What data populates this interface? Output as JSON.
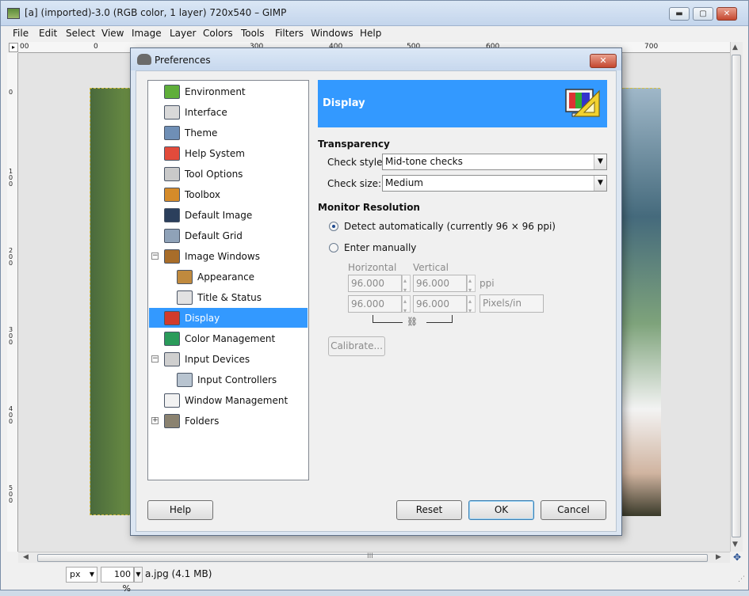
{
  "gimp": {
    "title": "[a] (imported)-3.0 (RGB color, 1 layer) 720x540 – GIMP",
    "window_buttons": {
      "minimize": "▬",
      "maximize": "▢",
      "close": "✕"
    },
    "menu": [
      "File",
      "Edit",
      "Select",
      "View",
      "Image",
      "Layer",
      "Colors",
      "Tools",
      "Filters",
      "Windows",
      "Help"
    ],
    "ruler_top_labels": [
      "00",
      "0",
      "300",
      "400",
      "500",
      "600",
      "700"
    ],
    "ruler_left_labels": [
      "0",
      "100",
      "200",
      "300",
      "400",
      "500"
    ],
    "status": {
      "unit": "px",
      "zoom": "100 %",
      "file": "a.jpg (4.1 MB)"
    },
    "scroll_grip": "III"
  },
  "prefs": {
    "title": "Preferences",
    "close_glyph": "✕",
    "tree": [
      {
        "label": "Environment",
        "icon": "environment-icon",
        "color": "#5fae3a"
      },
      {
        "label": "Interface",
        "icon": "interface-icon",
        "color": "#d9d9d9"
      },
      {
        "label": "Theme",
        "icon": "theme-icon",
        "color": "#6f8fb6"
      },
      {
        "label": "Help System",
        "icon": "help-system-icon",
        "color": "#e24b3b"
      },
      {
        "label": "Tool Options",
        "icon": "tool-options-icon",
        "color": "#c9c9c9"
      },
      {
        "label": "Toolbox",
        "icon": "toolbox-icon",
        "color": "#d58b2a"
      },
      {
        "label": "Default Image",
        "icon": "default-image-icon",
        "color": "#2b3f5c"
      },
      {
        "label": "Default Grid",
        "icon": "default-grid-icon",
        "color": "#8fa2b8"
      },
      {
        "label": "Image Windows",
        "icon": "image-windows-icon",
        "color": "#a86d2a",
        "expander": "−"
      },
      {
        "label": "Appearance",
        "icon": "appearance-icon",
        "color": "#c08a3e",
        "child": true
      },
      {
        "label": "Title & Status",
        "icon": "title-status-icon",
        "color": "#e2e2e2",
        "child": true
      },
      {
        "label": "Display",
        "icon": "display-icon",
        "color": "#d23b2b",
        "selected": true
      },
      {
        "label": "Color Management",
        "icon": "color-management-icon",
        "color": "#2a9b5a"
      },
      {
        "label": "Input Devices",
        "icon": "input-devices-icon",
        "color": "#cfcfcf",
        "expander": "−"
      },
      {
        "label": "Input Controllers",
        "icon": "input-controllers-icon",
        "color": "#b8c4d0",
        "child": true
      },
      {
        "label": "Window Management",
        "icon": "window-management-icon",
        "color": "#f2f2f2"
      },
      {
        "label": "Folders",
        "icon": "folders-icon",
        "color": "#8a8270",
        "expander": "+"
      }
    ],
    "header_title": "Display",
    "transparency": {
      "title": "Transparency",
      "check_style_label": "Check style:",
      "check_style_value": "Mid-tone checks",
      "check_size_label": "Check size:",
      "check_size_value": "Medium"
    },
    "monitor": {
      "title": "Monitor Resolution",
      "detect_label": "Detect automatically (currently 96 × 96 ppi)",
      "manual_label": "Enter manually",
      "horizontal_label": "Horizontal",
      "vertical_label": "Vertical",
      "h1": "96.000",
      "v1": "96.000",
      "ppi": "ppi",
      "h2": "96.000",
      "v2": "96.000",
      "unit": "Pixels/in",
      "calibrate": "Calibrate..."
    },
    "buttons": {
      "help": "Help",
      "reset": "Reset",
      "ok": "OK",
      "cancel": "Cancel"
    },
    "colors": {
      "accent": "#3399ff"
    }
  }
}
